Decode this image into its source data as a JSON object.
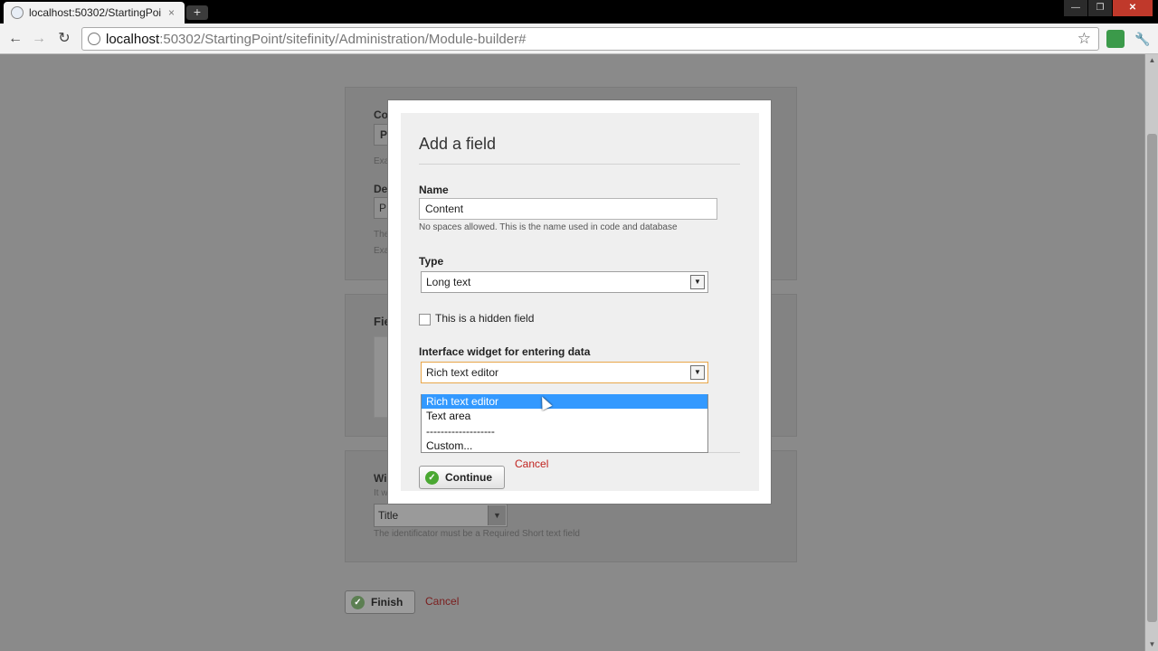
{
  "browser": {
    "tab_title": "localhost:50302/StartingPoi",
    "tab_close": "×",
    "new_tab": "+",
    "url_host": "localhost",
    "url_path": ":50302/StartingPoint/sitefinity/Administration/Module-builder#",
    "nav_back": "←",
    "nav_forward": "→",
    "nav_reload": "↻",
    "star": "☆",
    "wrench": "🔧",
    "win_minimize": "—",
    "win_maximize": "❐",
    "win_close": "✕"
  },
  "background": {
    "label_co": "Co",
    "value_p1": "P",
    "small_exa1": "Exa",
    "label_de": "De",
    "value_p2": "P",
    "small_the": "The",
    "small_exa2": "Exa",
    "label_fie": "Fie",
    "label_wi": "Wi",
    "small_it": "It w",
    "identifier_value": "Title",
    "identifier_hint": "The identificator must be a Required Short text field",
    "finish_label": "Finish",
    "cancel_label": "Cancel"
  },
  "dialog": {
    "title": "Add a field",
    "name_label": "Name",
    "name_value": "Content",
    "name_hint": "No spaces allowed. This is the name used in code and database",
    "type_label": "Type",
    "type_value": "Long text",
    "hidden_label": "This is a hidden field",
    "hidden_checked": false,
    "widget_label": "Interface widget for entering data",
    "widget_value": "Rich text editor",
    "widget_options": [
      "Rich text editor",
      "Text area",
      "-------------------",
      "Custom..."
    ],
    "widget_selected_index": 0,
    "continue_label": "Continue",
    "cancel_label": "Cancel"
  }
}
